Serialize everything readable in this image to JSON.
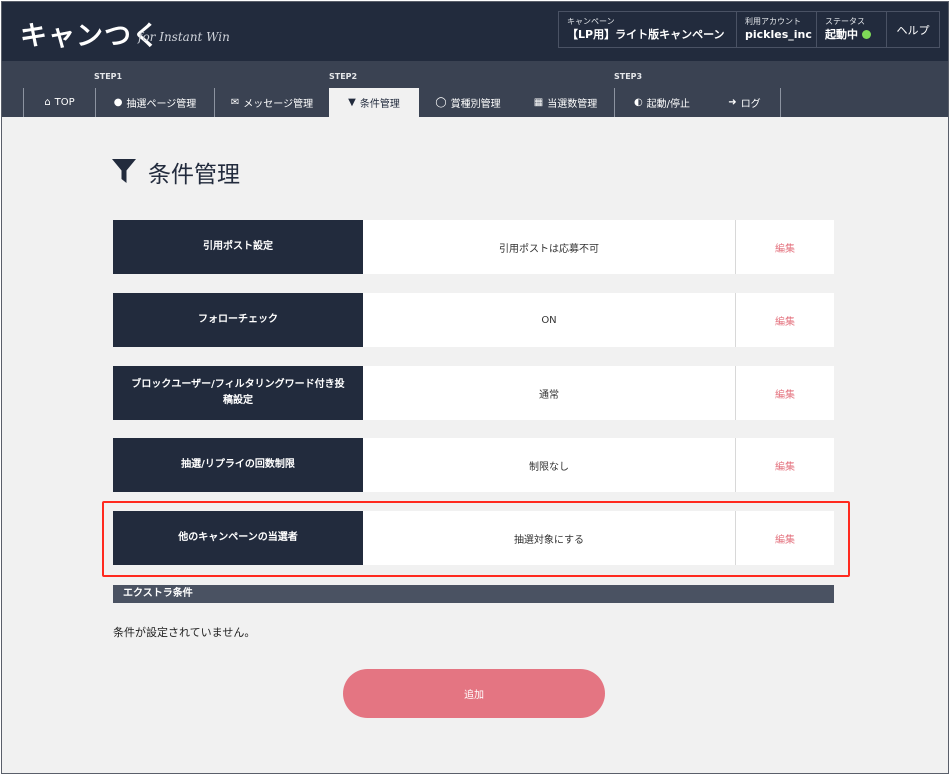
{
  "header": {
    "logo": "キャンつく",
    "logo_sub": "for Instant Win",
    "campaign_label": "キャンペーン",
    "campaign_value": "【LP用】ライト版キャンペーン",
    "account_label": "利用アカウント",
    "account_value": "pickles_inc",
    "status_label": "ステータス",
    "status_value": "起動中",
    "status_color": "#7ed957",
    "help": "ヘルプ"
  },
  "nav": {
    "steps": [
      "STEP1",
      "STEP2",
      "STEP3"
    ],
    "tabs": [
      {
        "label": "TOP",
        "icon": "home-icon"
      },
      {
        "label": "抽選ページ管理",
        "icon": "user-icon"
      },
      {
        "label": "メッセージ管理",
        "icon": "envelope-icon"
      },
      {
        "label": "条件管理",
        "icon": "filter-icon"
      },
      {
        "label": "賞種別管理",
        "icon": "award-icon"
      },
      {
        "label": "当選数管理",
        "icon": "sitemap-icon"
      },
      {
        "label": "起動/停止",
        "icon": "toggle-icon"
      },
      {
        "label": "ログ",
        "icon": "sign-in-icon"
      }
    ],
    "active_tab": "条件管理"
  },
  "page": {
    "title": "条件管理",
    "conditions": [
      {
        "label": "引用ポスト設定",
        "value": "引用ポストは応募不可",
        "edit": "編集"
      },
      {
        "label": "フォローチェック",
        "value": "ON",
        "edit": "編集"
      },
      {
        "label": "ブロックユーザー/フィルタリングワード付き投稿設定",
        "value": "通常",
        "edit": "編集"
      },
      {
        "label": "抽選/リプライの回数制限",
        "value": "制限なし",
        "edit": "編集"
      },
      {
        "label": "他のキャンペーンの当選者",
        "value": "抽選対象にする",
        "edit": "編集"
      }
    ],
    "extra_header": "エクストラ条件",
    "empty_message": "条件が設定されていません。",
    "add_button": "追加"
  },
  "colors": {
    "navy": "#222b3d",
    "accent_pink": "#e47582",
    "highlight_red": "#ff2a1f"
  }
}
